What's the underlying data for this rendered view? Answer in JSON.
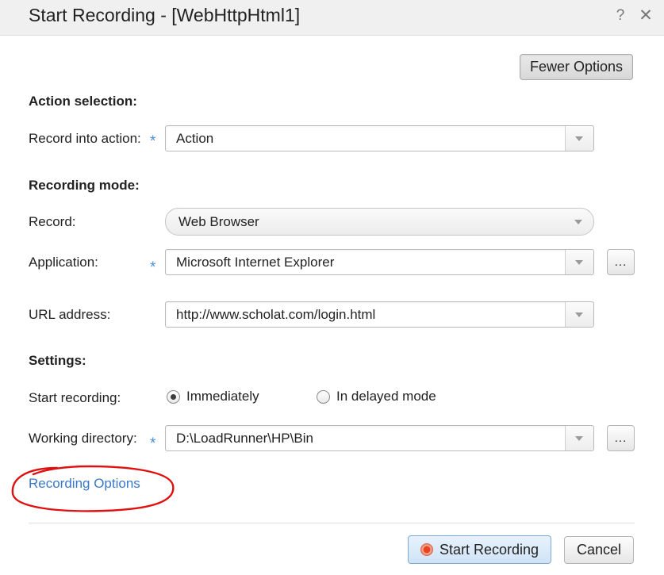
{
  "window": {
    "title": "Start Recording - [WebHttpHtml1]",
    "help_glyph": "?",
    "close_glyph": "✕"
  },
  "toolbar": {
    "fewer_options_label": "Fewer Options"
  },
  "action_selection": {
    "heading": "Action selection:",
    "record_into_label": "Record into action:",
    "record_into_value": "Action"
  },
  "recording_mode": {
    "heading": "Recording mode:",
    "record_label": "Record:",
    "record_value": "Web Browser",
    "application_label": "Application:",
    "application_value": "Microsoft Internet Explorer",
    "url_label": "URL address:",
    "url_value": "http://www.scholat.com/login.html"
  },
  "settings": {
    "heading": "Settings:",
    "start_recording_label": "Start recording:",
    "option_immediately": "Immediately",
    "option_delayed": "In delayed mode",
    "selected_option": "Immediately",
    "working_dir_label": "Working directory:",
    "working_dir_value": "D:\\LoadRunner\\HP\\Bin"
  },
  "required_marker": "*",
  "browse_label": "...",
  "recording_options_link": "Recording Options",
  "footer": {
    "start_label": "Start Recording",
    "cancel_label": "Cancel"
  },
  "colors": {
    "link": "#3a78c9",
    "required": "#4a90d9",
    "annotation": "#e01010",
    "record_icon": "#e8431e"
  }
}
